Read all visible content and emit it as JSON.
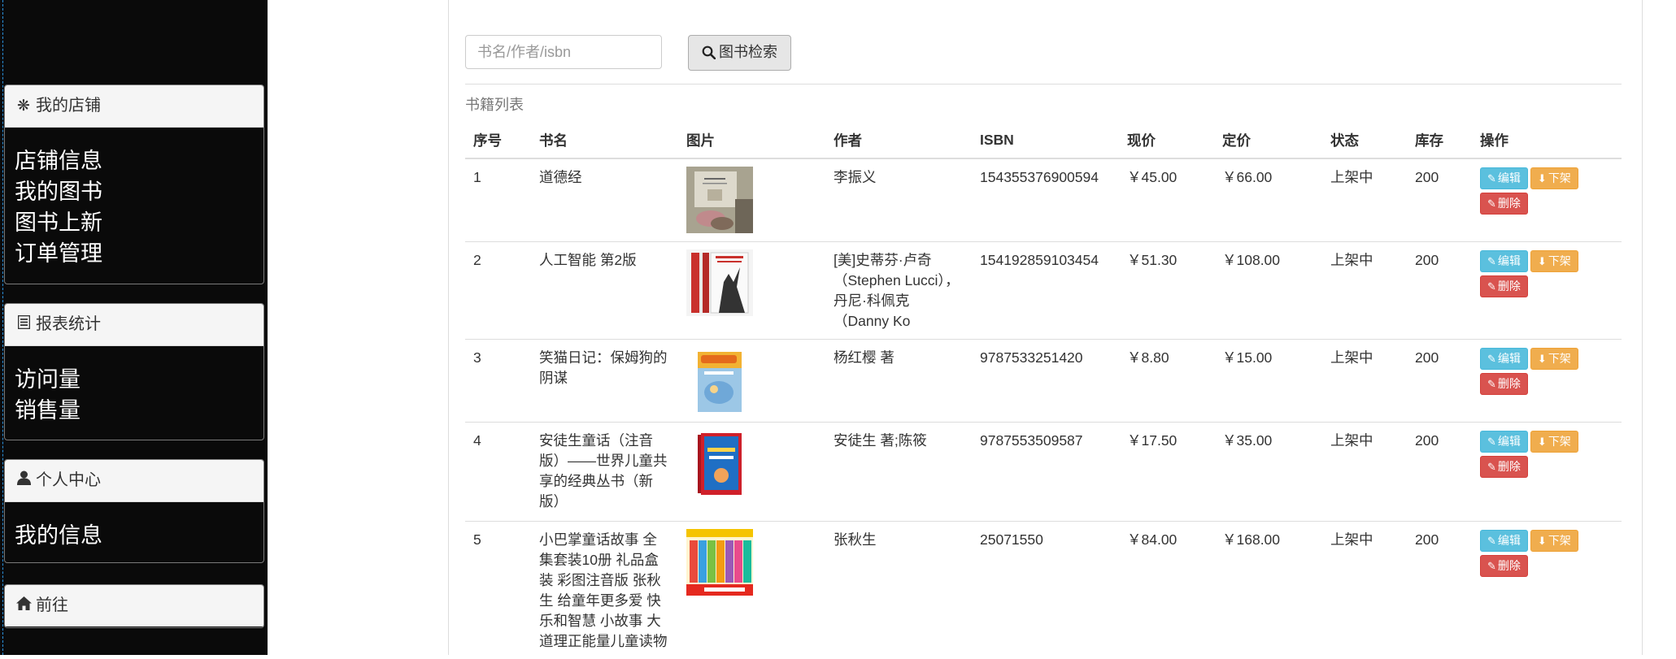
{
  "sidebar": {
    "shop": {
      "heading": "我的店铺",
      "icon": "asterisk-icon",
      "links": [
        "店铺信息",
        "我的图书",
        "图书上新",
        "订单管理"
      ]
    },
    "reports": {
      "heading": "报表统计",
      "icon": "list-icon",
      "links": [
        "访问量",
        "销售量"
      ]
    },
    "personal": {
      "heading": "个人中心",
      "icon": "user-icon",
      "links": [
        "我的信息"
      ]
    },
    "goto": {
      "heading": "前往",
      "icon": "home-icon"
    }
  },
  "search": {
    "placeholder": "书名/作者/isbn",
    "button_label": "图书检索"
  },
  "table": {
    "caption": "书籍列表",
    "headers": [
      "序号",
      "书名",
      "图片",
      "作者",
      "ISBN",
      "现价",
      "定价",
      "状态",
      "库存",
      "操作"
    ],
    "edit_label": "编辑",
    "offshelf_label": "下架",
    "delete_label": "删除",
    "rows": [
      {
        "no": "1",
        "title": "道德经",
        "author": "李振义",
        "isbn": "154355376900594",
        "price": "￥45.00",
        "list_price": "￥66.00",
        "status": "上架中",
        "stock": "200"
      },
      {
        "no": "2",
        "title": "人工智能 第2版",
        "author": "[美]史蒂芬·卢奇（Stephen Lucci），丹尼·科佩克（Danny Ko",
        "isbn": "154192859103454",
        "price": "￥51.30",
        "list_price": "￥108.00",
        "status": "上架中",
        "stock": "200"
      },
      {
        "no": "3",
        "title": "笑猫日记：保姆狗的阴谋",
        "author": "杨红樱 著",
        "isbn": "9787533251420",
        "price": "￥8.80",
        "list_price": "￥15.00",
        "status": "上架中",
        "stock": "200"
      },
      {
        "no": "4",
        "title": "安徒生童话（注音版）——世界儿童共享的经典丛书（新版）",
        "author": "安徒生 著;陈筱",
        "isbn": "9787553509587",
        "price": "￥17.50",
        "list_price": "￥35.00",
        "status": "上架中",
        "stock": "200"
      },
      {
        "no": "5",
        "title": "小巴掌童话故事 全集套装10册 礼品盒装 彩图注音版 张秋生 给童年更多爱 快乐和智慧 小故事 大道理正能量儿童读物",
        "author": "张秋生",
        "isbn": "25071550",
        "price": "￥84.00",
        "list_price": "￥168.00",
        "status": "上架中",
        "stock": "200"
      }
    ]
  },
  "colors": {
    "sidebar_bg": "#0a0a0a",
    "price_red": "#e0313a",
    "btn_edit": "#5bc0de",
    "btn_offshelf": "#f0ad4e",
    "btn_delete": "#d9534f"
  }
}
